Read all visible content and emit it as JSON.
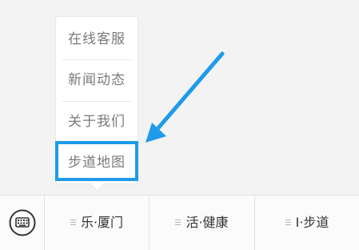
{
  "popup_menu": {
    "items": [
      {
        "label": "在线客服"
      },
      {
        "label": "新闻动态"
      },
      {
        "label": "关于我们"
      },
      {
        "label": "步道地图"
      }
    ],
    "highlighted_item": "步道地图"
  },
  "bottom_bar": {
    "keyboard_icon": "keyboard-icon",
    "tabs": [
      {
        "label": "乐·厦门",
        "icon": "menu-lines-icon"
      },
      {
        "label": "活·健康",
        "icon": "menu-lines-icon"
      },
      {
        "label": "I·步道",
        "icon": "menu-lines-icon"
      }
    ]
  },
  "annotation": {
    "color": "#1e9be9",
    "arrow_icon": "arrow-icon"
  }
}
